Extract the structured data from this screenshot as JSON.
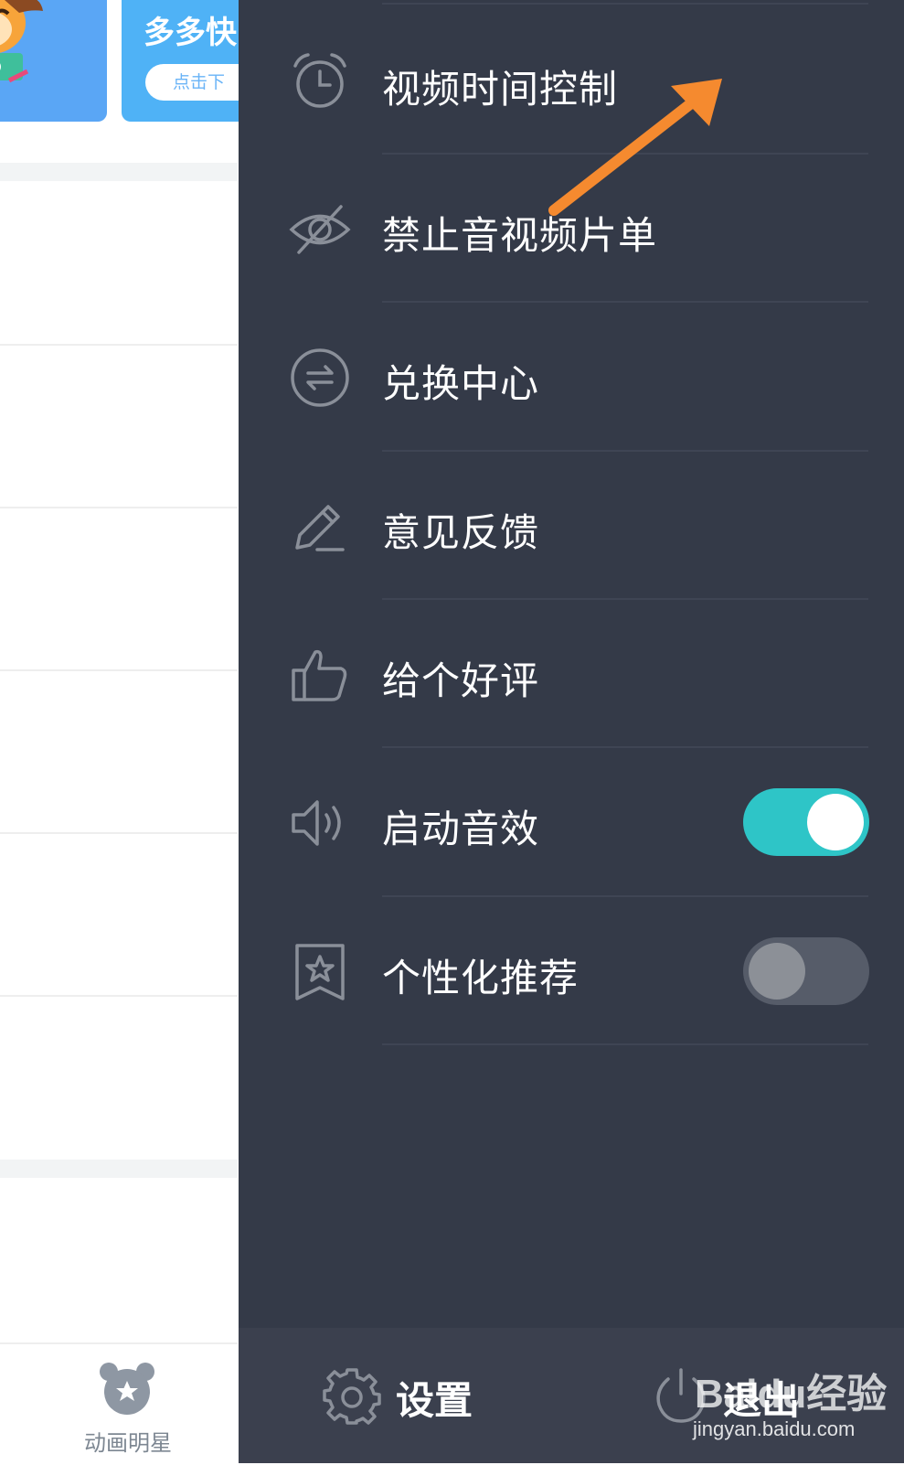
{
  "background_app": {
    "banner_title": "多多快",
    "banner_button": "点击下",
    "bottom_tab_label": "动画明星",
    "bottom_tab_icon": "bear-star-icon"
  },
  "drawer": {
    "items": [
      {
        "label": "视频时间控制",
        "icon": "alarm-clock-icon"
      },
      {
        "label": "禁止音视频片单",
        "icon": "eye-off-icon"
      },
      {
        "label": "兑换中心",
        "icon": "exchange-icon"
      },
      {
        "label": "意见反馈",
        "icon": "pencil-icon"
      },
      {
        "label": "给个好评",
        "icon": "thumbs-up-icon"
      },
      {
        "label": "启动音效",
        "icon": "speaker-icon",
        "toggle_on": true
      },
      {
        "label": "个性化推荐",
        "icon": "star-bookmark-icon",
        "toggle_on": false
      }
    ],
    "footer": {
      "settings_label": "设置",
      "logout_label": "退出"
    }
  },
  "annotation_arrow_color": "#f58a2f",
  "watermark": {
    "brand": "Baidu经验",
    "url": "jingyan.baidu.com"
  },
  "colors": {
    "drawer_bg": "#343a48",
    "footer_bg": "#3b404e",
    "toggle_on": "#2ec5c7",
    "toggle_off": "#565c69"
  }
}
